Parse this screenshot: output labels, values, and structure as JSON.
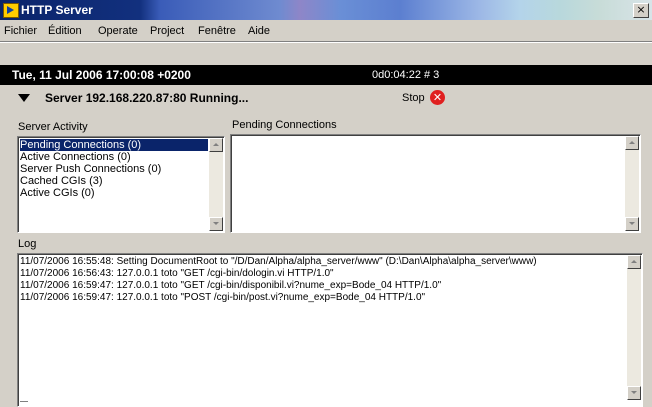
{
  "window": {
    "title": "HTTP Server",
    "close_glyph": "×"
  },
  "menu": [
    {
      "label": "Fichier"
    },
    {
      "label": "Édition"
    },
    {
      "label": "Operate"
    },
    {
      "label": "Project"
    },
    {
      "label": "Fenêtre"
    },
    {
      "label": "Aide"
    }
  ],
  "status": {
    "datetime": "Tue, 11 Jul 2006 17:00:08 +0200",
    "counter": "0d0:04:22 # 3"
  },
  "server": {
    "label": "Server 192.168.220.87:80 Running...",
    "stop_label": "Stop",
    "stop_glyph": "✕"
  },
  "activity": {
    "label": "Server Activity",
    "items": [
      {
        "label": "Pending Connections (0)",
        "selected": true
      },
      {
        "label": "Active Connections (0)"
      },
      {
        "label": "Server Push Connections (0)"
      },
      {
        "label": "Cached CGIs (3)"
      },
      {
        "label": "Active CGIs (0)"
      }
    ]
  },
  "pending": {
    "label": "Pending Connections"
  },
  "log": {
    "label": "Log",
    "lines": [
      "11/07/2006 16:55:48: Setting DocumentRoot to \"/D/Dan/Alpha/alpha_server/www\" (D:\\Dan\\Alpha\\alpha_server\\www)",
      "11/07/2006 16:56:43: 127.0.0.1 toto \"GET /cgi-bin/dologin.vi HTTP/1.0\"",
      "11/07/2006 16:59:47: 127.0.0.1 toto \"GET /cgi-bin/disponibil.vi?nume_exp=Bode_04 HTTP/1.0\"",
      "11/07/2006 16:59:47: 127.0.0.1 toto \"POST /cgi-bin/post.vi?nume_exp=Bode_04 HTTP/1.0\""
    ]
  },
  "colors": {
    "status_bg": "#000000",
    "selection": "#0a246a",
    "stop": "#e02020"
  }
}
